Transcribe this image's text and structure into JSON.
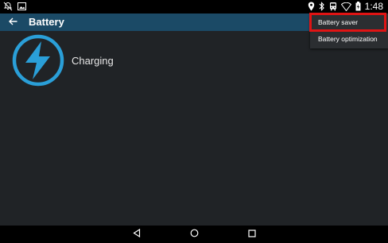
{
  "status_bar": {
    "time": "1:48",
    "icons": [
      "notification-muted-icon",
      "image-notification-icon",
      "location-icon",
      "bluetooth-icon",
      "bus-icon",
      "wifi-icon",
      "battery-charging-icon"
    ]
  },
  "app_bar": {
    "title": "Battery",
    "back_icon": "arrow-back-icon"
  },
  "content": {
    "status_label": "Charging",
    "status_icon": "charging-bolt-icon"
  },
  "menu": {
    "items": [
      {
        "label": "Battery saver",
        "highlighted": true
      },
      {
        "label": "Battery optimization",
        "highlighted": false
      }
    ]
  },
  "nav_bar": {
    "icons": [
      "back-icon",
      "home-icon",
      "recent-apps-icon"
    ]
  },
  "colors": {
    "background": "#202326",
    "app_bar": "#1b4a66",
    "accent": "#2a9fd8",
    "highlight": "#e01414"
  }
}
